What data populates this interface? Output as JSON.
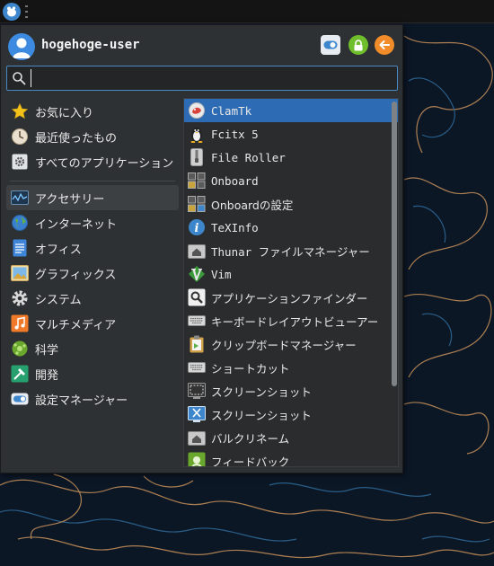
{
  "user": {
    "name": "hogehoge-user"
  },
  "header_buttons": {
    "settings_icon": "settings-toggle-icon",
    "lock_icon": "lock-icon",
    "logout_icon": "logout-arrow-icon"
  },
  "search": {
    "value": "",
    "placeholder": ""
  },
  "categories": [
    {
      "label": "お気に入り",
      "icon": "star-icon"
    },
    {
      "label": "最近使ったもの",
      "icon": "clock-icon"
    },
    {
      "label": "すべてのアプリケーション",
      "icon": "gear-icon"
    },
    {
      "label": "アクセサリー",
      "icon": "accessories-icon"
    },
    {
      "label": "インターネット",
      "icon": "globe-icon"
    },
    {
      "label": "オフィス",
      "icon": "document-icon"
    },
    {
      "label": "グラフィックス",
      "icon": "picture-icon"
    },
    {
      "label": "システム",
      "icon": "cog-icon"
    },
    {
      "label": "マルチメディア",
      "icon": "music-note-icon"
    },
    {
      "label": "科学",
      "icon": "science-icon"
    },
    {
      "label": "開発",
      "icon": "hammer-icon"
    },
    {
      "label": "設定マネージャー",
      "icon": "toggle-icon"
    }
  ],
  "active_category": "アクセサリー",
  "apps": [
    {
      "label": "ClamTk",
      "icon": "clamtk-icon"
    },
    {
      "label": "Fcitx 5",
      "icon": "penguin-icon"
    },
    {
      "label": "File Roller",
      "icon": "archive-icon"
    },
    {
      "label": "Onboard",
      "icon": "onboard-icon"
    },
    {
      "label": "Onboardの設定",
      "icon": "onboard-settings-icon"
    },
    {
      "label": "TeXInfo",
      "icon": "info-icon"
    },
    {
      "label": "Thunar ファイルマネージャー",
      "icon": "folder-home-icon"
    },
    {
      "label": "Vim",
      "icon": "vim-icon"
    },
    {
      "label": "アプリケーションファインダー",
      "icon": "magnifier-icon"
    },
    {
      "label": "キーボードレイアウトビューアー",
      "icon": "keyboard-icon"
    },
    {
      "label": "クリップボードマネージャー",
      "icon": "clipboard-icon"
    },
    {
      "label": "ショートカット",
      "icon": "keyboard-icon"
    },
    {
      "label": "スクリーンショット",
      "icon": "screenshot-icon"
    },
    {
      "label": "スクリーンショット",
      "icon": "screenshot-tool-icon"
    },
    {
      "label": "バルクリネーム",
      "icon": "folder-home-icon"
    },
    {
      "label": "フィードバック",
      "icon": "feedback-icon"
    }
  ],
  "selected_app": "ClamTk",
  "colors": {
    "accent": "#2d6cb4",
    "search_border": "#4a88c4",
    "menu_bg": "#2e3133",
    "wallpaper": "#0c1726",
    "wallpaper_lines_warm": "#c8925a",
    "wallpaper_lines_cool": "#2f6a98"
  }
}
